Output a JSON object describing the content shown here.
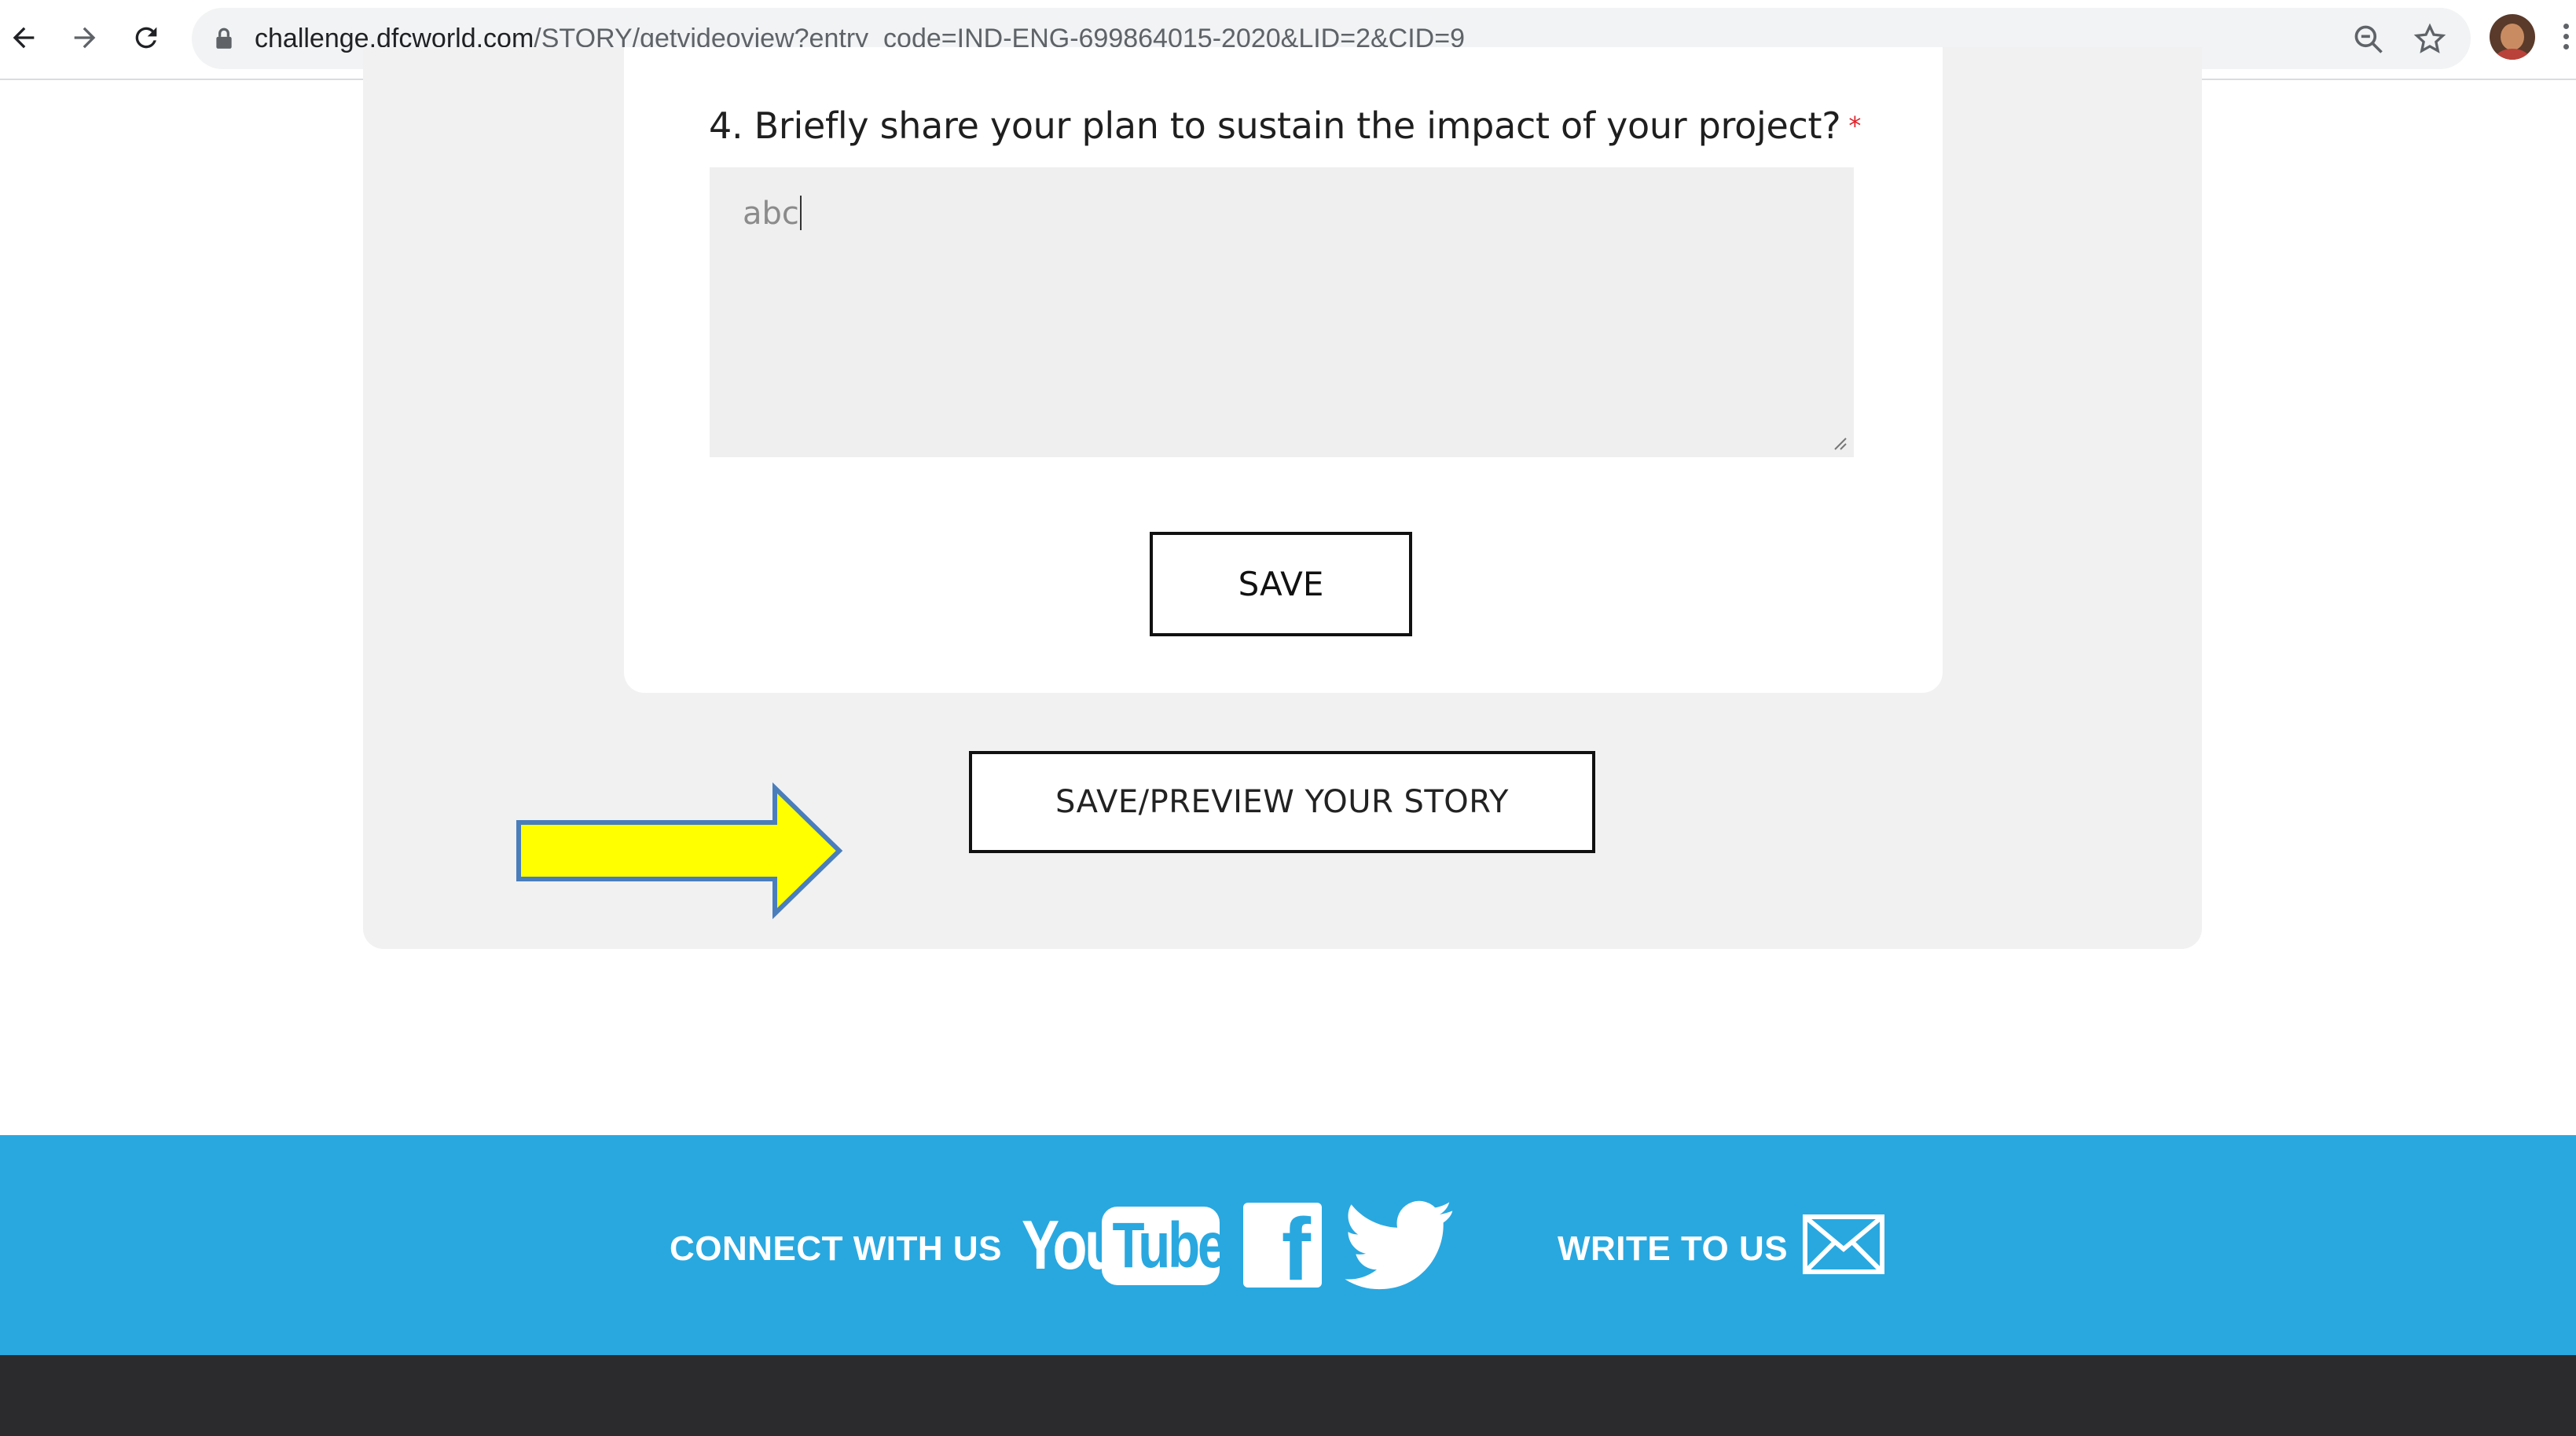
{
  "browser": {
    "url_host": "challenge.dfcworld.com",
    "url_rest": "/STORY/getvideoview?entry_code=IND-ENG-699864015-2020&LID=2&CID=9"
  },
  "form": {
    "question": "4. Briefly share your plan to sustain the impact of your project?",
    "required_mark": "*",
    "answer_value": "abc",
    "save_label": "SAVE",
    "preview_label": "SAVE/PREVIEW YOUR STORY"
  },
  "footer": {
    "connect_label": "CONNECT WITH US",
    "youtube_you": "You",
    "youtube_tube": "Tube",
    "facebook_letter": "f",
    "write_label": "WRITE TO US"
  },
  "colors": {
    "footer_blue": "#29a8e0",
    "footer_dark": "#2b2b2d",
    "arrow_fill": "#ffff00",
    "arrow_stroke": "#4a7ebb",
    "required": "#e0242c"
  },
  "icons": [
    "back-icon",
    "forward-icon",
    "reload-icon",
    "lock-icon",
    "zoom-icon",
    "star-icon",
    "profile-avatar",
    "menu-icon",
    "arrow-annotation",
    "youtube-icon",
    "facebook-icon",
    "twitter-icon",
    "mail-icon"
  ]
}
